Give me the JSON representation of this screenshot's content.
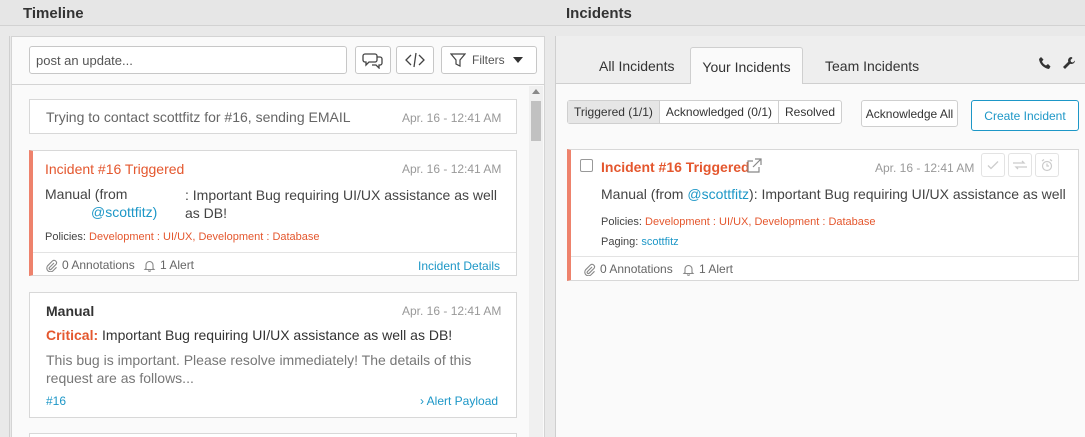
{
  "header": {
    "timeline_title": "Timeline",
    "incidents_title": "Incidents"
  },
  "timeline": {
    "post_placeholder": "post an update...",
    "filters_label": "Filters",
    "event": {
      "text": "Trying to contact scottfitz for #16, sending EMAIL",
      "time": "Apr. 16 - 12:41 AM"
    },
    "incident_card": {
      "title": "Incident #16 Triggered",
      "time": "Apr. 16 - 12:41 AM",
      "body_prefix": "Manual (from",
      "body_user": "@scottfitz)",
      "body_suffix": ": Important Bug requiring UI/UX assistance as well as DB!",
      "policies_label": "Policies:",
      "policies_value": "Development : UI/UX, Development : Database",
      "annotations": "0 Annotations",
      "alerts": "1 Alert",
      "details_link": "Incident Details"
    },
    "manual_card": {
      "title": "Manual",
      "time": "Apr. 16 - 12:41 AM",
      "critical_label": "Critical:",
      "critical_text": "Important Bug requiring UI/UX assistance as well as DB!",
      "description": "This bug is important. Please resolve immediately! The details of this request are as follows...",
      "ref": "#16",
      "payload_link": "Alert Payload"
    }
  },
  "incidents": {
    "tabs": [
      "All Incidents",
      "Your Incidents",
      "Team Incidents"
    ],
    "active_tab": "Your Incidents",
    "filters": {
      "triggered": "Triggered (1/1)",
      "acknowledged": "Acknowledged (0/1)",
      "resolved": "Resolved"
    },
    "acknowledge_all": "Acknowledge All",
    "create_incident": "Create Incident",
    "card": {
      "title": "Incident #16 Triggered",
      "time": "Apr. 16 - 12:41 AM",
      "body_prefix": "Manual (from ",
      "body_user": "@scottfitz",
      "body_suffix": "): Important Bug requiring UI/UX assistance as well",
      "policies_label": "Policies:",
      "policies_value": "Development : UI/UX, Development : Database",
      "paging_label": "Paging:",
      "paging_value": "scottfitz",
      "annotations": "0 Annotations",
      "alerts": "1 Alert"
    }
  },
  "colors": {
    "accent": "#1d97c7",
    "triggered": "#e4572e",
    "triggered_border": "#ee826c"
  }
}
